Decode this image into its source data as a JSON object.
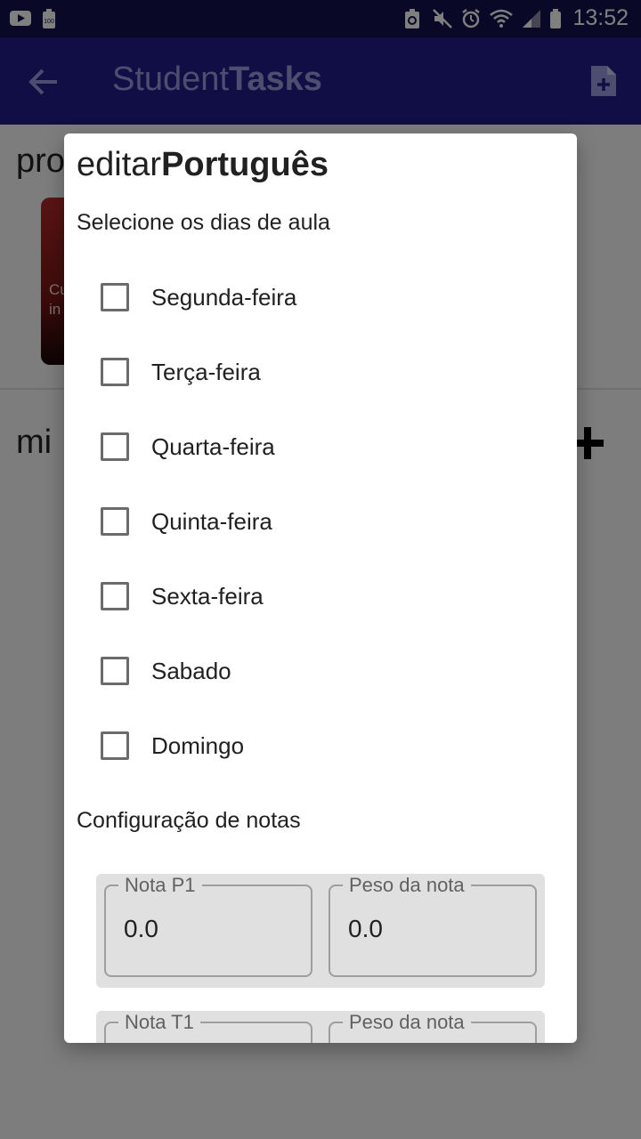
{
  "status_bar": {
    "time": "13:52",
    "icons": [
      "youtube-icon",
      "battery-saver-icon",
      "recycle-icon",
      "mute-icon",
      "alarm-icon",
      "wifi-icon",
      "signal-icon",
      "battery-icon"
    ],
    "badge": "100"
  },
  "app_bar": {
    "title_light": "Student",
    "title_bold": "Tasks",
    "back_icon": "arrow-back-icon",
    "action_icon": "note-add-icon"
  },
  "background": {
    "section1_title": "pro",
    "card_line1": "Cu",
    "card_line2": "in",
    "section2_title": "mi",
    "plus_icon": "plus-icon"
  },
  "dialog": {
    "title_prefix": "editar",
    "title_subject": "Português",
    "days_heading": "Selecione os dias de aula",
    "days": [
      {
        "label": "Segunda-feira",
        "checked": false
      },
      {
        "label": "Terça-feira",
        "checked": false
      },
      {
        "label": "Quarta-feira",
        "checked": false
      },
      {
        "label": "Quinta-feira",
        "checked": false
      },
      {
        "label": "Sexta-feira",
        "checked": false
      },
      {
        "label": "Sabado",
        "checked": false
      },
      {
        "label": "Domingo",
        "checked": false
      }
    ],
    "grades_heading": "Configuração de notas",
    "grades": [
      {
        "grade_label": "Nota P1",
        "grade_value": "0.0",
        "weight_label": "Peso da nota",
        "weight_value": "0.0"
      },
      {
        "grade_label": "Nota T1",
        "grade_value": "",
        "weight_label": "Peso da nota",
        "weight_value": ""
      }
    ]
  },
  "colors": {
    "status_bar": "#13114e",
    "app_bar": "#201c8a",
    "dialog_bg": "#ffffff",
    "field_group_bg": "#e0e0e0"
  }
}
